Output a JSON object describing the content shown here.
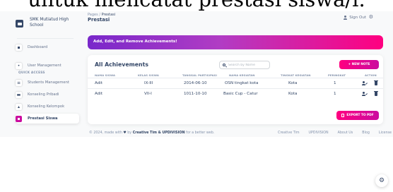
{
  "caption": "untuk mencatat prestasi siswa/i.",
  "sidebar": {
    "brand": "SMK Mutiatud High School",
    "items": [
      {
        "label": "Dashboard",
        "icon": "shop-icon"
      },
      {
        "label": "User Management",
        "icon": "user-icon"
      },
      {
        "label": "Students Management",
        "icon": "list-icon"
      },
      {
        "label": "Konseling Pribadi",
        "icon": "card-icon"
      },
      {
        "label": "Konseling Kelompok",
        "icon": "group-icon"
      },
      {
        "label": "Prestasi Siswa",
        "icon": "trophy-icon"
      }
    ],
    "section_heading": "QUICK ACCESS"
  },
  "topbar": {
    "breadcrumb_root": "Pages",
    "breadcrumb_separator": "/",
    "breadcrumb_current": "Prestasi",
    "title": "Prestasi",
    "signout": "Sign Out"
  },
  "banner": "Add, Edit, and Remove Achievements!",
  "achievements": {
    "title": "All Achievements",
    "search_placeholder": "Search by Name",
    "new_button": "+ NEW NOTE",
    "export_button": "EXPORT TO PDF",
    "columns": [
      "NAMA SISWA",
      "KELAS SISWA",
      "TANGGAL PARTISIPASI",
      "NAMA KEGIATAN",
      "TINGKAT KEGIATAN",
      "PERINGKAT",
      "ACTION"
    ],
    "rows": [
      {
        "nama": "Adit",
        "kelas": "IX-III",
        "tanggal": "2014-06-10",
        "kegiatan": "OSN tingkat kota",
        "tingkat": "Kota",
        "peringkat": "1"
      },
      {
        "nama": "Adit",
        "kelas": "VII-I",
        "tanggal": "1011-10-10",
        "kegiatan": "Basic Cup - Catur",
        "tingkat": "Kota",
        "peringkat": "1"
      }
    ]
  },
  "footer": {
    "copyright_prefix": "© 2024, made with",
    "copyright_by": "by",
    "authors": "Creative Tim & UPDIVISION",
    "copyright_suffix": "for a better web.",
    "links": [
      "Creative Tim",
      "UPDIVISION",
      "About Us",
      "Blog",
      "License"
    ]
  },
  "colors": {
    "accent_pink": "#cb0c9f",
    "banner_start": "#7928ca",
    "banner_end": "#ff0080",
    "text_dark": "#344767",
    "text_muted": "#8392ab"
  }
}
